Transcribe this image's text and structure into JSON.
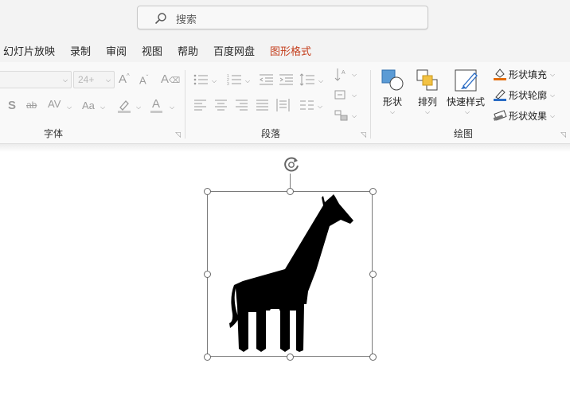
{
  "search": {
    "placeholder": "搜索"
  },
  "menu": {
    "items": [
      {
        "label": "幻灯片放映"
      },
      {
        "label": "录制"
      },
      {
        "label": "审阅"
      },
      {
        "label": "视图"
      },
      {
        "label": "帮助"
      },
      {
        "label": "百度网盘"
      },
      {
        "label": "图形格式"
      }
    ],
    "active_color": "#c43e1c"
  },
  "ribbon": {
    "font_group": {
      "label": "字体",
      "font_size_value": "24+",
      "buttons": {
        "grow": "A^",
        "shrink": "Aˇ",
        "shadow": "S",
        "strike": "ab",
        "spacing": "AV",
        "case": "Aa",
        "font_color": "A"
      }
    },
    "paragraph_group": {
      "label": "段落"
    },
    "drawing_group": {
      "label": "绘图",
      "shape_label": "形状",
      "arrange_label": "排列",
      "quick_styles_label": "快速样式",
      "fill_label": "形状填充",
      "outline_label": "形状轮廓",
      "effects_label": "形状效果",
      "fill_color": "#e46c0a",
      "outline_color": "#2b6cc4"
    }
  },
  "canvas": {
    "selected_object": "giraffe-icon",
    "selection_color": "#7a7a7a"
  }
}
